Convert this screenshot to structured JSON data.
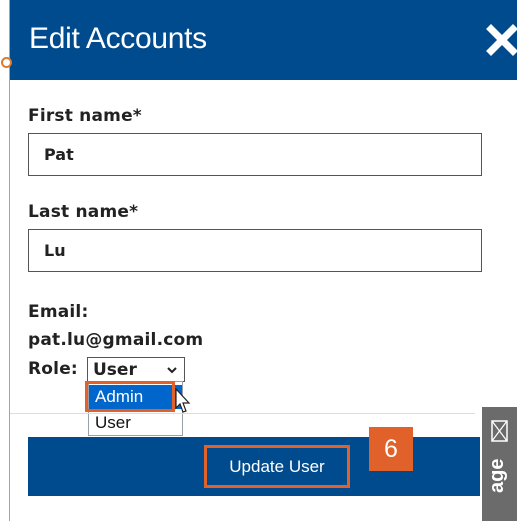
{
  "dialog": {
    "title": "Edit Accounts",
    "close_icon": "close-x-icon"
  },
  "form": {
    "first_name": {
      "label": "First name*",
      "value": "Pat"
    },
    "last_name": {
      "label": "Last name*",
      "value": "Lu"
    },
    "email": {
      "label": "Email:",
      "value": "pat.lu@gmail.com"
    },
    "role": {
      "label": "Role:",
      "selected": "User",
      "options": [
        "Admin",
        "User"
      ],
      "highlighted_option": "Admin"
    }
  },
  "actions": {
    "update_label": "Update User"
  },
  "annotation": {
    "step_number": "6"
  },
  "feedback_tab": {
    "label": "age"
  },
  "colors": {
    "header_bg": "#004b8d",
    "highlight_orange": "#e0612a",
    "option_selected_bg": "#0066cc"
  }
}
